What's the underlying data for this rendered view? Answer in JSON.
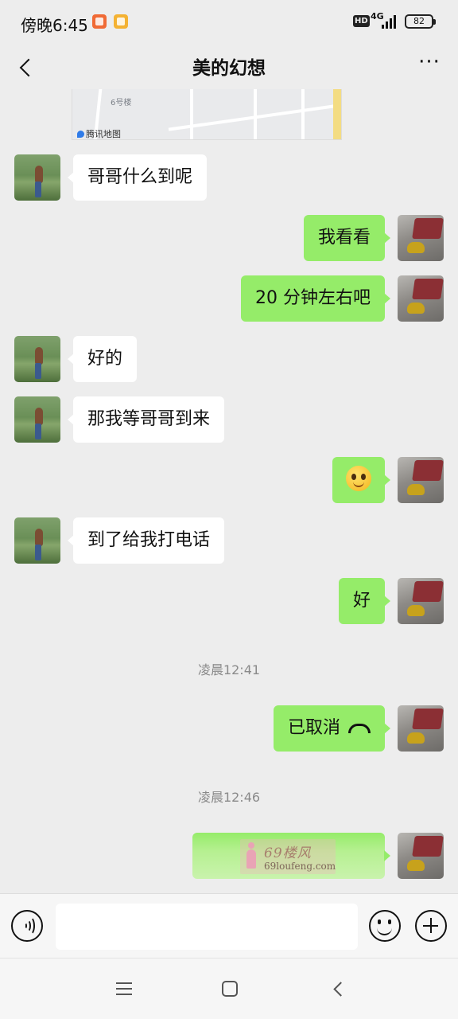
{
  "status_bar": {
    "time": "傍晚6:45",
    "network": "4G",
    "hd": "HD",
    "battery": "82",
    "icons": [
      "notification-icon",
      "notification-icon",
      "hd-icon",
      "signal-icon",
      "battery-icon"
    ]
  },
  "header": {
    "title": "美的幻想",
    "back_icon": "chevron-left-icon",
    "more_label": "···"
  },
  "map_card": {
    "building_label": "6号楼",
    "brand": "腾讯地图"
  },
  "messages": [
    {
      "side": "in",
      "text": "哥哥什么到呢"
    },
    {
      "side": "out",
      "text": "我看看"
    },
    {
      "side": "out",
      "text": "20 分钟左右吧"
    },
    {
      "side": "in",
      "text": "好的"
    },
    {
      "side": "in",
      "text": "那我等哥哥到来"
    },
    {
      "side": "out",
      "type": "emoji",
      "icon": "smiley-emoji-icon"
    },
    {
      "side": "in",
      "text": "到了给我打电话"
    },
    {
      "side": "out",
      "text": "好"
    },
    {
      "type": "timestamp",
      "text": "凌晨12:41"
    },
    {
      "side": "out",
      "text": "已取消",
      "icon": "phone-hangup-icon"
    },
    {
      "type": "timestamp",
      "text": "凌晨12:46"
    },
    {
      "side": "out",
      "type": "sticker",
      "watermark_line1": "69楼风",
      "watermark_line2": "69loufeng.com"
    }
  ],
  "input_bar": {
    "voice_icon": "voice-icon",
    "input_value": "",
    "emoji_icon": "emoji-icon",
    "plus_icon": "plus-icon"
  },
  "nav_bar": {
    "icons": [
      "menu-icon",
      "home-icon",
      "back-icon"
    ]
  }
}
